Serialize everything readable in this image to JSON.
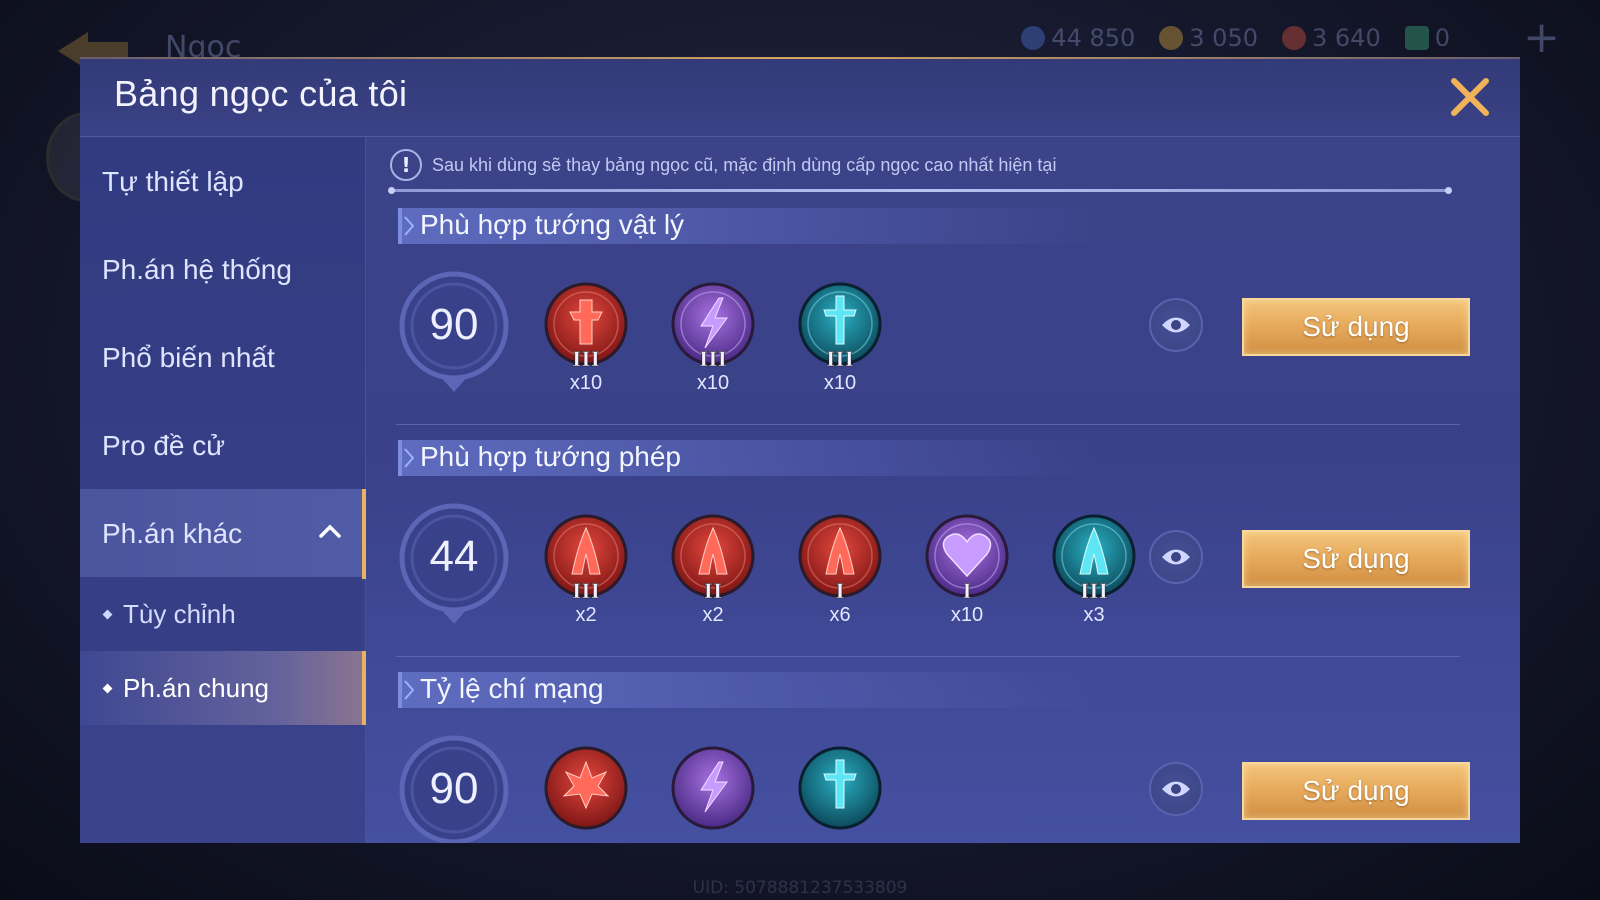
{
  "background": {
    "title": "Ngọc",
    "currencies": [
      {
        "icon": "blue-coin-icon",
        "value": "44 850",
        "color": "#4a6cc8"
      },
      {
        "icon": "gold-coin-icon",
        "value": "3 050",
        "color": "#c89a3a"
      },
      {
        "icon": "red-gem-icon",
        "value": "3 640",
        "color": "#c84a3a"
      },
      {
        "icon": "green-ticket-icon",
        "value": "0",
        "color": "#3aa07a"
      }
    ],
    "uid": "UID: 5078881237533809"
  },
  "modal": {
    "title": "Bảng ngọc của tôi",
    "close_icon": "close-icon",
    "accent_color": "#e9b25e"
  },
  "sidebar": {
    "items": [
      {
        "label": "Tự thiết lập"
      },
      {
        "label": "Ph.án hệ thống"
      },
      {
        "label": "Phổ biến nhất"
      },
      {
        "label": "Pro đề cử"
      },
      {
        "label": "Ph.án khác",
        "expanded": true
      }
    ],
    "sub_items": [
      {
        "label": "Tùy chỉnh"
      },
      {
        "label": "Ph.án chung",
        "active": true
      }
    ]
  },
  "notice": {
    "icon": "warning-icon",
    "text": "Sau khi dùng sẽ thay bảng ngọc cũ, mặc định dùng cấp ngọc cao nhất hiện tại"
  },
  "sections": [
    {
      "title": "Phù hợp tướng vật lý",
      "level": "90",
      "gems": [
        {
          "color": "red",
          "symbol": "sword",
          "tier": "III",
          "count": "x10"
        },
        {
          "color": "purple",
          "symbol": "bolt",
          "tier": "III",
          "count": "x10"
        },
        {
          "color": "teal",
          "symbol": "sword",
          "tier": "III",
          "count": "x10"
        }
      ],
      "use_label": "Sử dụng"
    },
    {
      "title": "Phù hợp tướng phép",
      "level": "44",
      "gems": [
        {
          "color": "red",
          "symbol": "flame",
          "tier": "III",
          "count": "x2"
        },
        {
          "color": "red",
          "symbol": "flame",
          "tier": "II",
          "count": "x2"
        },
        {
          "color": "red",
          "symbol": "flame",
          "tier": "I",
          "count": "x6"
        },
        {
          "color": "purple",
          "symbol": "heart",
          "tier": "I",
          "count": "x10"
        },
        {
          "color": "teal",
          "symbol": "flame",
          "tier": "III",
          "count": "x3"
        }
      ],
      "use_label": "Sử dụng"
    },
    {
      "title": "Tỷ lệ chí mạng",
      "level": "90",
      "gems": [
        {
          "color": "red",
          "symbol": "burst",
          "tier": "",
          "count": ""
        },
        {
          "color": "purple",
          "symbol": "bolt",
          "tier": "",
          "count": ""
        },
        {
          "color": "teal",
          "symbol": "sword",
          "tier": "",
          "count": ""
        }
      ],
      "use_label": "Sử dụng"
    }
  ]
}
